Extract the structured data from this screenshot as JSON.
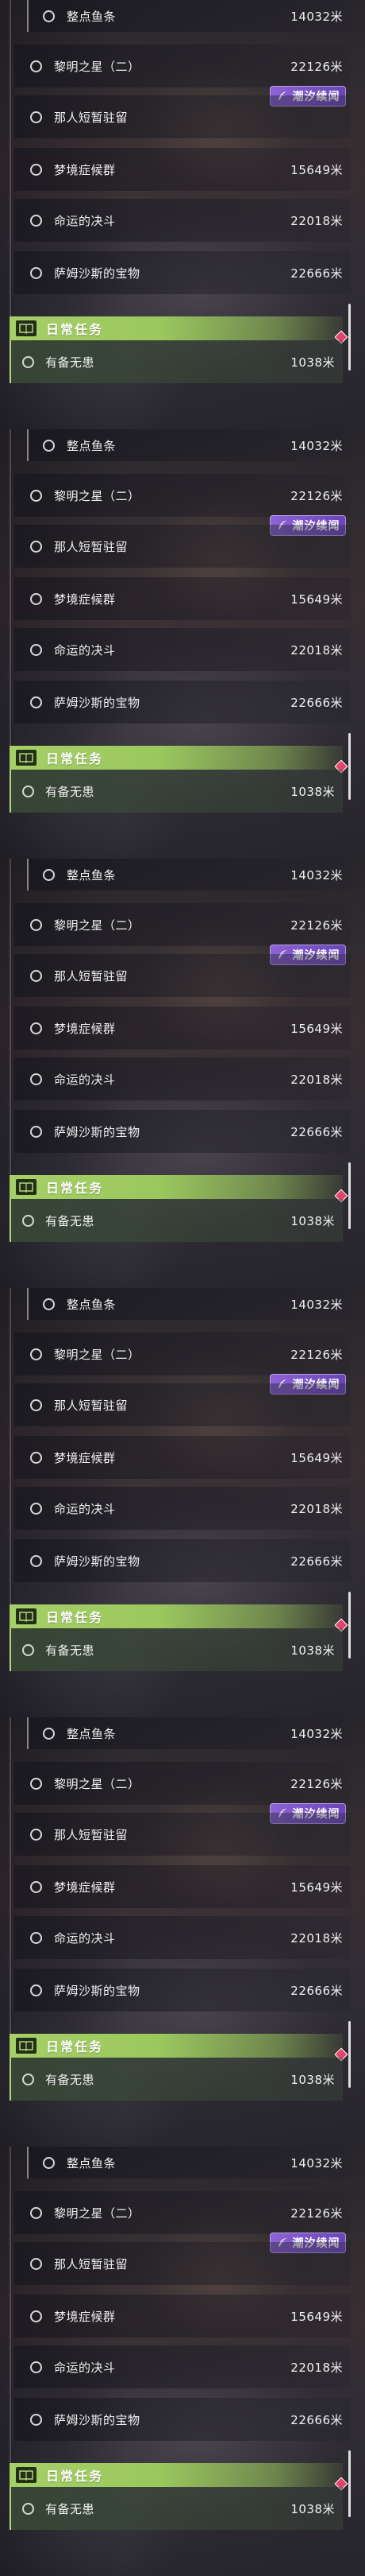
{
  "panels": [
    {
      "label": "panel-1"
    },
    {
      "label": "panel-2"
    },
    {
      "label": "panel-3"
    },
    {
      "label": "panel-4"
    },
    {
      "label": "panel-5"
    },
    {
      "label": "panel-6"
    }
  ],
  "quest_list": {
    "items": [
      {
        "name": "整点鱼条",
        "distance": "14032米"
      },
      {
        "name": "黎明之星（二）",
        "distance": "22126米"
      },
      {
        "name": "那人短暂驻留",
        "distance": ""
      },
      {
        "name": "梦境症候群",
        "distance": "15649米"
      },
      {
        "name": "命运的决斗",
        "distance": "22018米"
      },
      {
        "name": "萨姆沙斯的宝物",
        "distance": "22666米"
      }
    ],
    "badge": {
      "label": "潮汐续闻",
      "icon": "feather-icon",
      "color": "#7b53c8"
    }
  },
  "daily": {
    "header": "日常任务",
    "header_icon": "book-icon",
    "accent": "#9bc85d",
    "alert_color": "#e0466c",
    "items": [
      {
        "name": "有备无患",
        "distance": "1038米"
      }
    ]
  }
}
